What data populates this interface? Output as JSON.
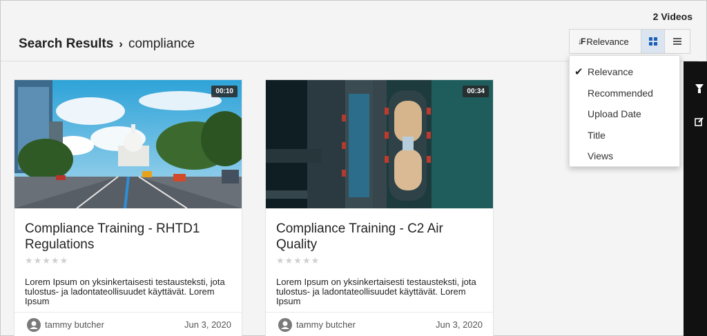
{
  "video_count": "2 Videos",
  "breadcrumb": {
    "root": "Search Results",
    "separator": "›",
    "query": "compliance"
  },
  "toolbar": {
    "sort_label": "Relevance",
    "sort_icon": "sort-desc-icon",
    "grid_icon": "grid-view-icon",
    "list_icon": "list-view-icon"
  },
  "sort_menu": {
    "items": [
      "Relevance",
      "Recommended",
      "Upload Date",
      "Title",
      "Views"
    ],
    "selected": "Relevance",
    "check": "✔"
  },
  "sidebar": {
    "icons": [
      "filter-icon",
      "edit-icon"
    ]
  },
  "videos": [
    {
      "duration": "00:10",
      "title": "Compliance Training - RHTD1 Regulations",
      "rating_stars": "★★★★★",
      "rating": 0,
      "description": "Lorem Ipsum on yksinkertaisesti testausteksti, jota tulostus- ja ladontateollisuudet käyttävät. Lorem Ipsum",
      "author": "tammy butcher",
      "date": "Jun 3, 2020"
    },
    {
      "duration": "00:34",
      "title": "Compliance Training - C2 Air Quality",
      "rating_stars": "★★★★★",
      "rating": 0,
      "description": "Lorem Ipsum on yksinkertaisesti testausteksti, jota tulostus- ja ladontateollisuudet käyttävät. Lorem Ipsum",
      "author": "tammy butcher",
      "date": "Jun 3, 2020"
    }
  ],
  "colors": {
    "accent": "#1a5fb4",
    "sidebar_bg": "#111111",
    "background": "#f4f4f4"
  }
}
